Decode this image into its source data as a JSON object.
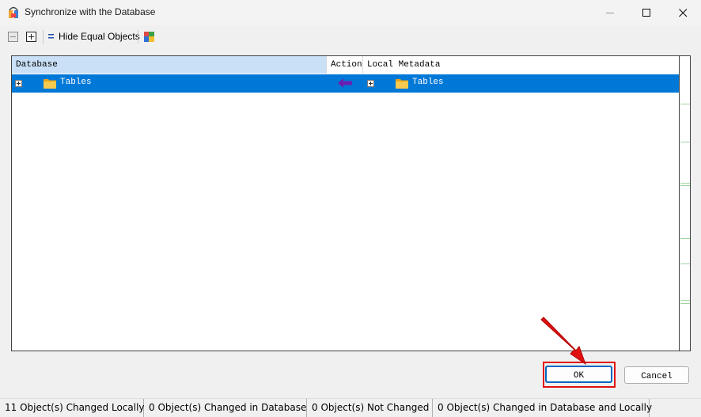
{
  "window": {
    "title": "Synchronize with the Database"
  },
  "toolbar": {
    "collapse_icon": "minus-box-icon",
    "expand_icon": "plus-box-icon",
    "hide_equal_label": "Hide Equal Objects",
    "colors_icon": "color-palette-icon"
  },
  "grid": {
    "columns": {
      "database": "Database",
      "action": "Action",
      "local": "Local Metadata"
    },
    "rows": [
      {
        "database_label": "Tables",
        "local_label": "Tables",
        "action_icon": "arrow-left-icon",
        "selected": true
      }
    ]
  },
  "buttons": {
    "ok": "OK",
    "cancel": "Cancel"
  },
  "status": {
    "changed_locally": "11 Object(s) Changed Locally",
    "changed_db": "0 Object(s) Changed in Database",
    "not_changed": "0 Object(s) Not Changed",
    "changed_both": "0 Object(s) Changed in Database and Locally"
  },
  "colors": {
    "selection": "#0078d7",
    "header_highlight": "#c9e0f7",
    "annotation_red": "#e01010",
    "action_arrow": "#6a1fb0"
  }
}
